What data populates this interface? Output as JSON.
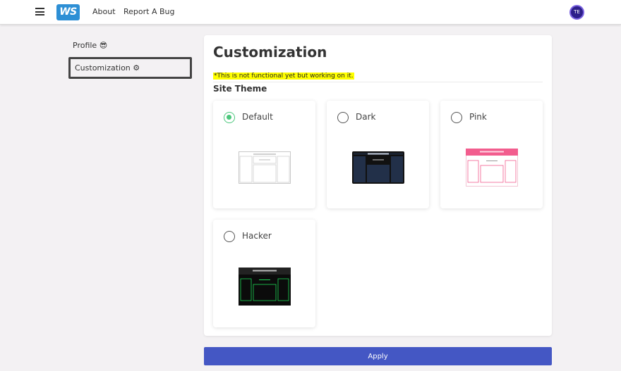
{
  "header": {
    "logo_text": "WS",
    "nav": [
      "About",
      "Report A Bug"
    ],
    "avatar_initials": "TE"
  },
  "sidebar": {
    "items": [
      {
        "label": "Profile 😎"
      },
      {
        "label": "Customization ⚙"
      }
    ]
  },
  "main": {
    "title": "Customization",
    "note": "*This is not functional yet but working on it.",
    "section_title": "Site Theme",
    "themes": [
      {
        "label": "Default",
        "selected": true
      },
      {
        "label": "Dark",
        "selected": false
      },
      {
        "label": "Pink",
        "selected": false
      },
      {
        "label": "Hacker",
        "selected": false
      }
    ]
  },
  "actions": {
    "apply_label": "Apply"
  },
  "colors": {
    "accent": "#4457c4",
    "logo": "#2d8fd5",
    "selected_radio": "#4cc77c",
    "note_highlight": "#ffff00",
    "avatar": "#2d1f8a"
  }
}
